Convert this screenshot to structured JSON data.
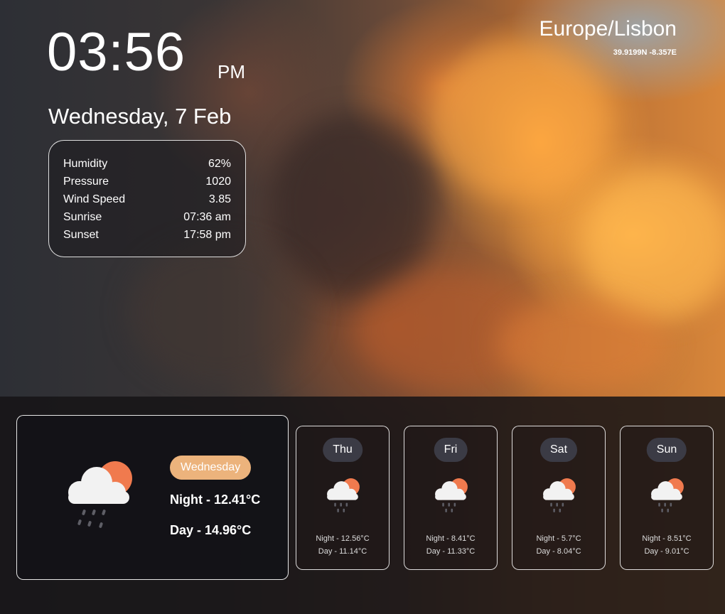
{
  "clock": {
    "time": "03:56",
    "ampm": "PM",
    "date": "Wednesday, 7 Feb"
  },
  "location": {
    "timezone": "Europe/Lisbon",
    "coords": "39.9199N -8.357E"
  },
  "stats": [
    {
      "label": "Humidity",
      "value": "62%"
    },
    {
      "label": "Pressure",
      "value": "1020"
    },
    {
      "label": "Wind Speed",
      "value": "3.85"
    },
    {
      "label": "Sunrise",
      "value": "07:36 am"
    },
    {
      "label": "Sunset",
      "value": "17:58 pm"
    }
  ],
  "today": {
    "day": "Wednesday",
    "night": "Night - 12.41°C",
    "daytemp": "Day - 14.96°C",
    "icon": "cloud-sun-rain-icon"
  },
  "forecast": [
    {
      "day": "Thu",
      "night": "Night - 12.56°C",
      "daytemp": "Day - 11.14°C",
      "icon": "cloud-sun-rain-icon"
    },
    {
      "day": "Fri",
      "night": "Night - 8.41°C",
      "daytemp": "Day - 11.33°C",
      "icon": "cloud-sun-rain-icon"
    },
    {
      "day": "Sat",
      "night": "Night - 5.7°C",
      "daytemp": "Day - 8.04°C",
      "icon": "cloud-sun-rain-icon"
    },
    {
      "day": "Sun",
      "night": "Night - 8.51°C",
      "daytemp": "Day - 9.01°C",
      "icon": "cloud-sun-rain-icon"
    }
  ],
  "colors": {
    "accent": "#ecb37c",
    "sun": "#f07a4e",
    "pill": "#3b3b45"
  }
}
